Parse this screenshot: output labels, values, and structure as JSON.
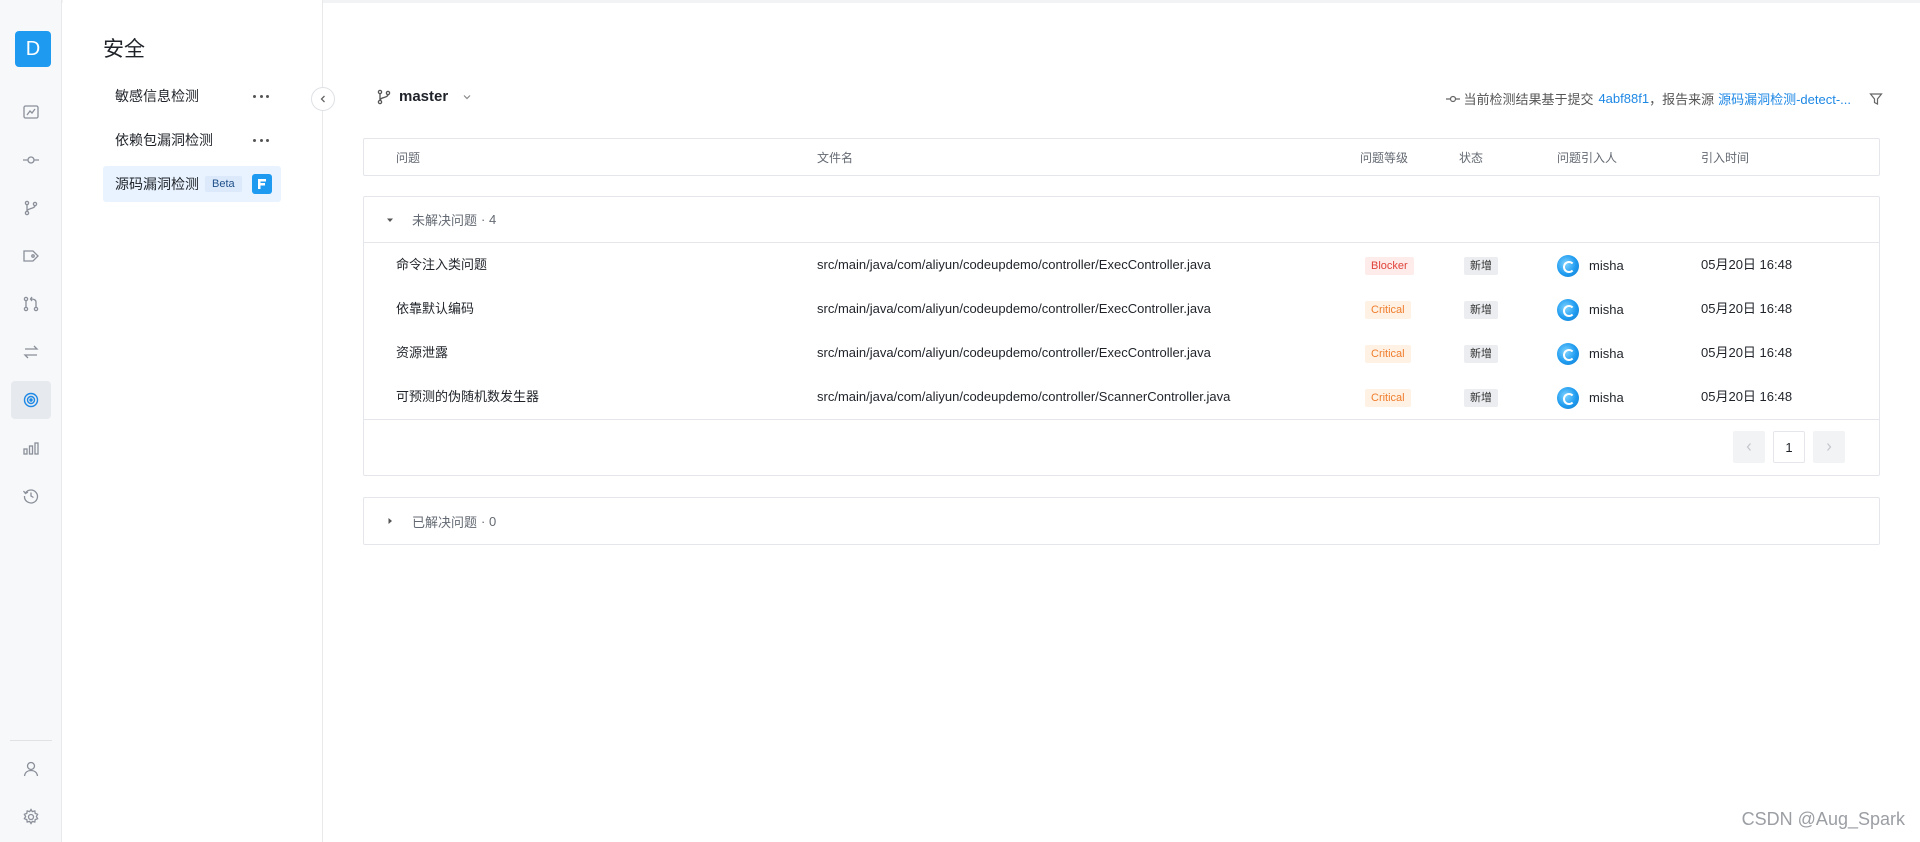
{
  "workspace": {
    "avatar_letter": "D"
  },
  "rail": {
    "icons": [
      "home-icon",
      "commit-icon",
      "branch-icon",
      "tag-icon",
      "merge-request-icon",
      "compare-icon",
      "security-icon",
      "stats-icon",
      "history-icon",
      "member-icon",
      "settings-icon"
    ],
    "active": "security-icon"
  },
  "subnav": {
    "title": "安全",
    "items": [
      {
        "label": "敏感信息检测",
        "more": true
      },
      {
        "label": "依赖包漏洞检测",
        "more": true
      },
      {
        "label": "源码漏洞检测",
        "badge": "Beta",
        "active": true
      }
    ]
  },
  "toolbar": {
    "branch": "master",
    "commit_prefix": "当前检测结果基于提交",
    "commit_hash": "4abf88f1",
    "source_prefix": "，报告来源",
    "source_link": "源码漏洞检测-detect-..."
  },
  "table": {
    "headers": {
      "issue": "问题",
      "file": "文件名",
      "level": "问题等级",
      "status": "状态",
      "author": "问题引入人",
      "time": "引入时间"
    }
  },
  "unresolved": {
    "label": "未解决问题",
    "count": "· 4",
    "rows": [
      {
        "issue": "命令注入类问题",
        "file": "src/main/java/com/aliyun/codeupdemo/controller/ExecController.java",
        "level": "Blocker",
        "status": "新增",
        "author": "misha",
        "time": "05月20日 16:48"
      },
      {
        "issue": "依靠默认编码",
        "file": "src/main/java/com/aliyun/codeupdemo/controller/ExecController.java",
        "level": "Critical",
        "status": "新增",
        "author": "misha",
        "time": "05月20日 16:48"
      },
      {
        "issue": "资源泄露",
        "file": "src/main/java/com/aliyun/codeupdemo/controller/ExecController.java",
        "level": "Critical",
        "status": "新增",
        "author": "misha",
        "time": "05月20日 16:48"
      },
      {
        "issue": "可预测的伪随机数发生器",
        "file": "src/main/java/com/aliyun/codeupdemo/controller/ScannerController.java",
        "level": "Critical",
        "status": "新增",
        "author": "misha",
        "time": "05月20日 16:48"
      }
    ],
    "page": "1"
  },
  "resolved": {
    "label": "已解决问题",
    "count": "· 0"
  },
  "colors": {
    "accent": "#1e9bf0",
    "link": "#1e88e5",
    "blocker": "#e0433a",
    "critical": "#ef7d2c"
  },
  "watermark": "CSDN @Aug_Spark"
}
